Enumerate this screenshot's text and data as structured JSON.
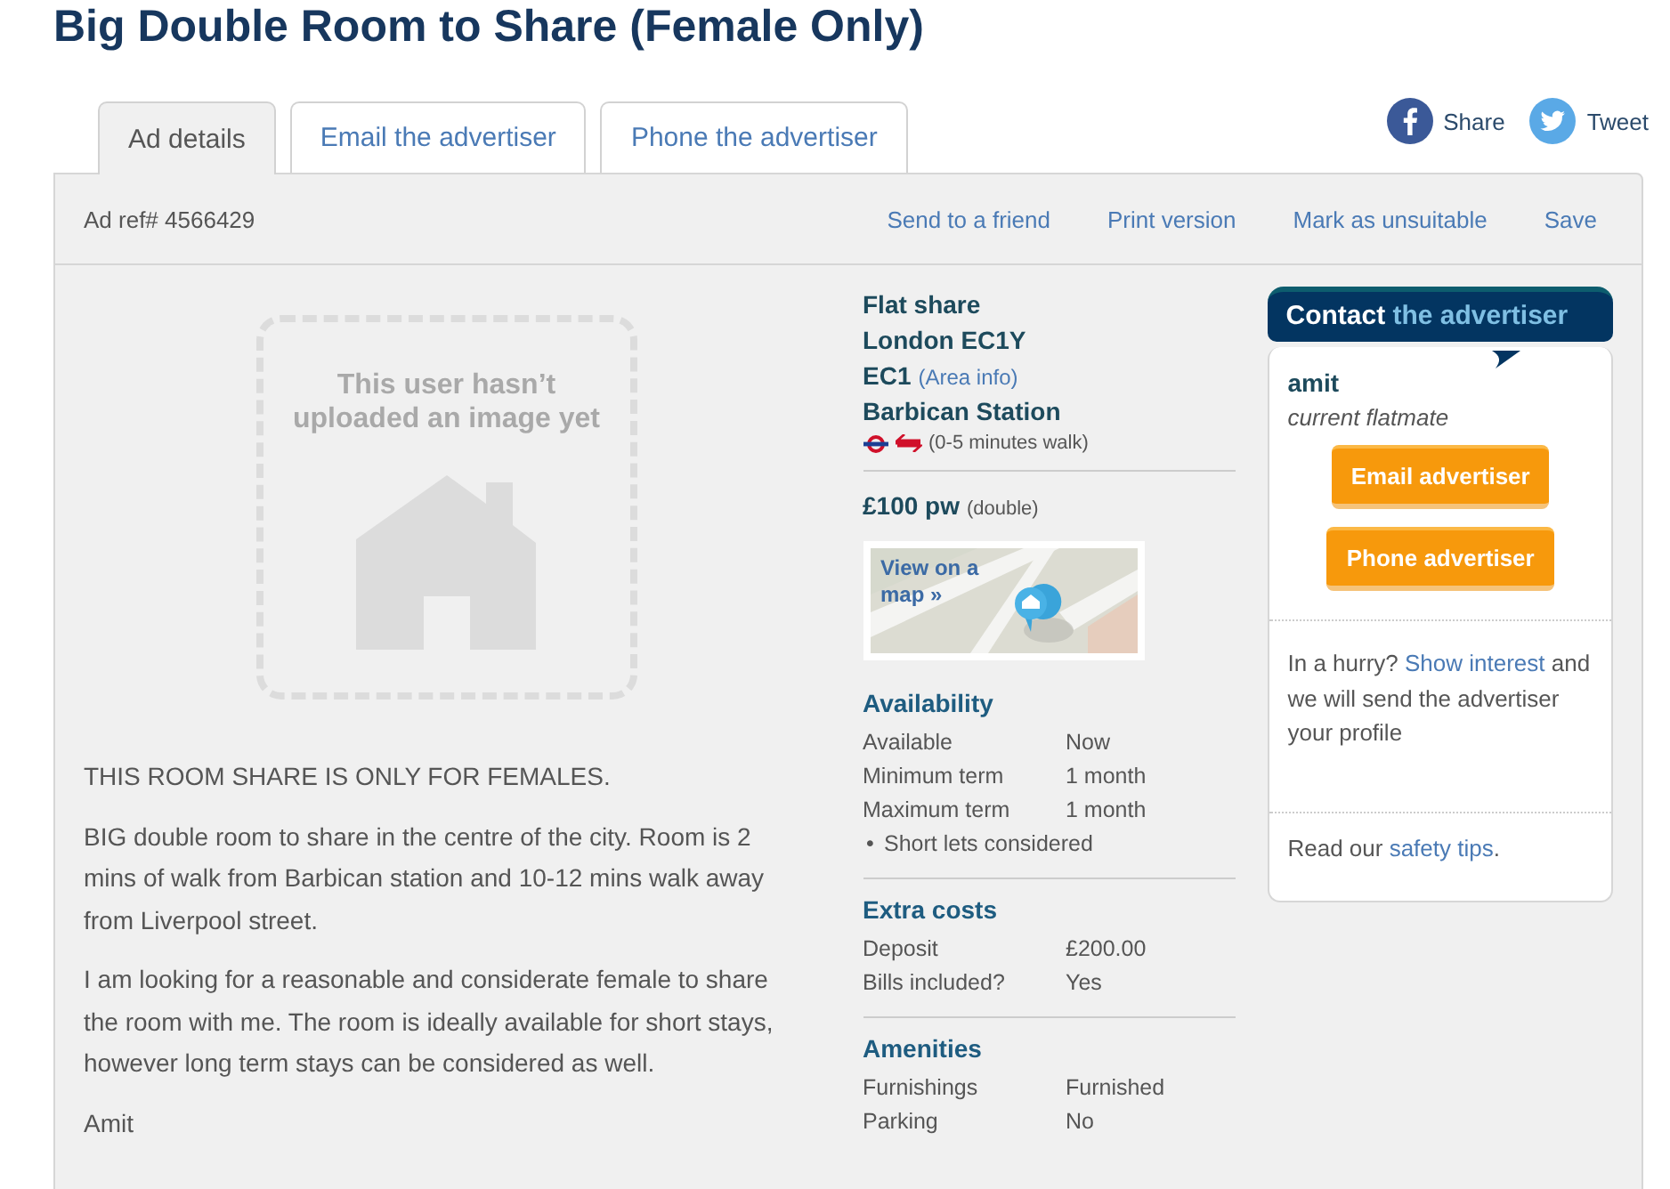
{
  "title": "Big Double Room to Share (Female Only)",
  "tabs": [
    {
      "label": "Ad details",
      "selected": true
    },
    {
      "label": "Email the advertiser",
      "selected": false
    },
    {
      "label": "Phone the advertiser",
      "selected": false
    }
  ],
  "social": [
    {
      "kind": "facebook",
      "label": "Share"
    },
    {
      "kind": "twitter",
      "label": "Tweet"
    }
  ],
  "ad_ref": "Ad ref# 4566429",
  "actions": [
    "Send to a friend",
    "Print version",
    "Mark as unsuitable",
    "Save"
  ],
  "image_placeholder": {
    "text": "This user hasn’t uploaded an image yet"
  },
  "description": [
    "THIS ROOM SHARE IS ONLY FOR FEMALES.",
    "BIG double room to share in the centre of the city. Room is 2 mins of walk from Barbican station and 10-12 mins walk away from Liverpool street.",
    "I am looking for a reasonable and considerate female to share the room with me. The room is ideally available for short stays, however long term stays can be considered as well.",
    "Amit"
  ],
  "summary": {
    "type": "Flat share",
    "location": "London EC1Y",
    "area": "EC1",
    "area_link": "(Area info)",
    "station": "Barbican Station",
    "walk": "(0-5 minutes walk)",
    "price": "£100 pw",
    "price_note": "(double)",
    "map_link": "View on a map »"
  },
  "sections": [
    {
      "title": "Availability",
      "rows": [
        {
          "label": "Available",
          "value": "Now"
        },
        {
          "label": "Minimum term",
          "value": "1 month"
        },
        {
          "label": "Maximum term",
          "value": "1 month"
        }
      ],
      "bullets": [
        {
          "marker": "•",
          "text": "Short lets considered"
        }
      ]
    },
    {
      "title": "Extra costs",
      "rows": [
        {
          "label": "Deposit",
          "value": "£200.00"
        },
        {
          "label": "Bills included?",
          "value": "Yes"
        }
      ]
    },
    {
      "title": "Amenities",
      "rows": [
        {
          "label": "Furnishings",
          "value": "Furnished"
        },
        {
          "label": "Parking",
          "value": "No"
        }
      ]
    }
  ],
  "contact": {
    "heading": "Contact",
    "heading_rest": "the advertiser",
    "name": "amit",
    "role": "current flatmate",
    "buttons": [
      "Email advertiser",
      "Phone advertiser"
    ],
    "hurry": {
      "before": "In a hurry?",
      "link": "Show interest",
      "after": "and we will send the advertiser your profile"
    },
    "safety": {
      "before": "Read our",
      "link": "safety tips",
      "after": "."
    }
  }
}
